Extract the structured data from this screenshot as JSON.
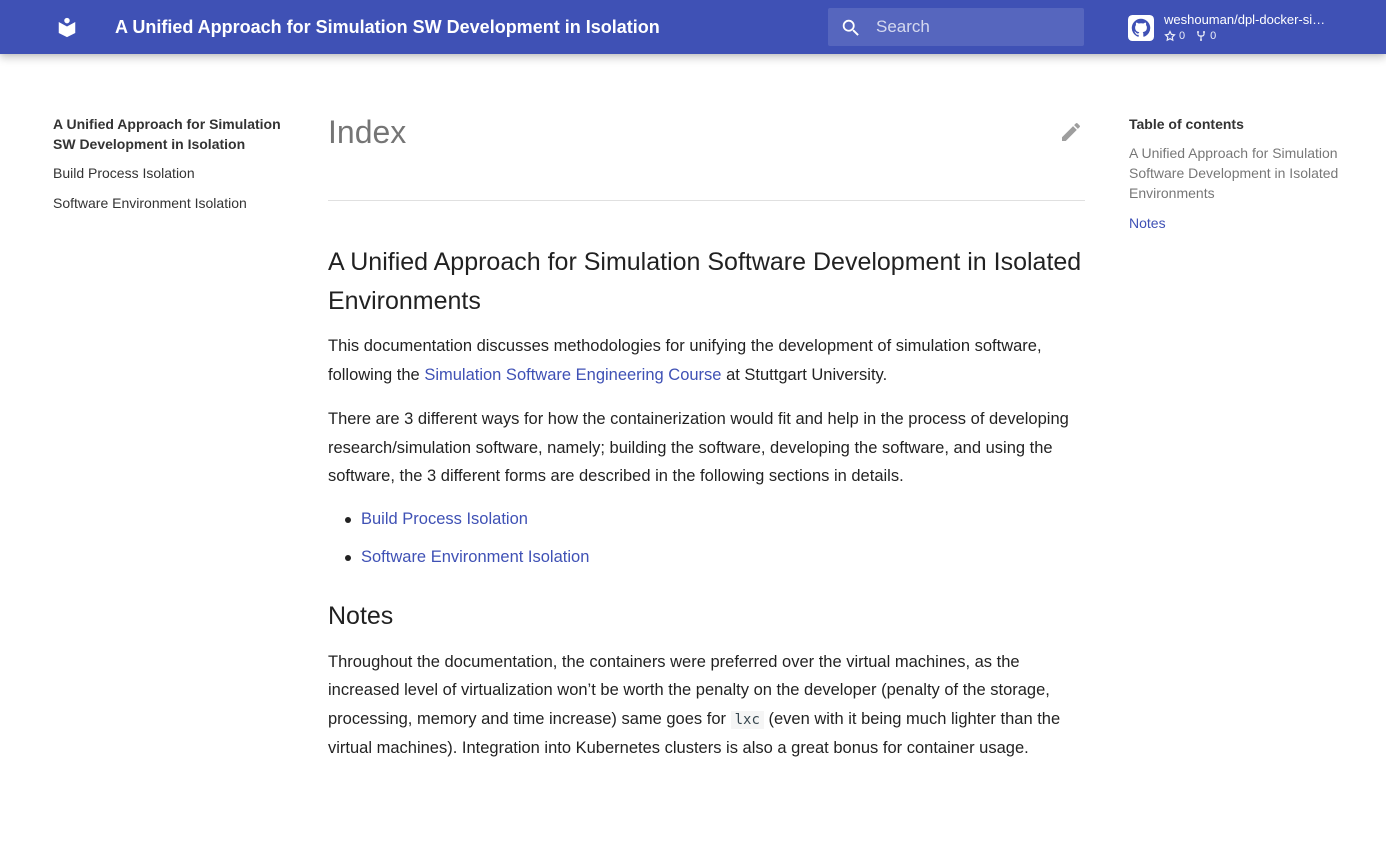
{
  "header": {
    "site_title": "A Unified Approach for Simulation SW Development in Isolation",
    "search_placeholder": "Search",
    "repo_name": "weshouman/dpl-docker-si…",
    "stars": "0",
    "forks": "0"
  },
  "nav": {
    "title": "A Unified Approach for Simulation SW Development in Isolation",
    "items": [
      {
        "label": "Build Process Isolation"
      },
      {
        "label": "Software Environment Isolation"
      }
    ]
  },
  "main": {
    "page_title": "Index",
    "section1_heading": "A Unified Approach for Simulation Software Development in Isolated Environments",
    "p1_before": "This documentation discusses methodologies for unifying the development of simulation software, following the ",
    "p1_link": "Simulation Software Engineering Course",
    "p1_after": " at Stuttgart University.",
    "p2": "There are 3 different ways for how the containerization would fit and help in the process of developing research/simulation software, namely; building the software, developing the software, and using the software, the 3 different forms are described in the following sections in details.",
    "links": [
      {
        "label": "Build Process Isolation"
      },
      {
        "label": "Software Environment Isolation"
      }
    ],
    "notes_heading": "Notes",
    "p3_before": "Throughout the documentation, the containers were preferred over the virtual machines, as the increased level of virtualization won’t be worth the penalty on the developer (penalty of the storage, processing, memory and time increase) same goes for ",
    "p3_code": "lxc",
    "p3_after": " (even with it being much lighter than the virtual machines). Integration into Kubernetes clusters is also a great bonus for container usage."
  },
  "toc": {
    "title": "Table of contents",
    "items": [
      {
        "label": "A Unified Approach for Simulation Software Development in Isolated Environments"
      },
      {
        "label": "Notes"
      }
    ]
  },
  "colors": {
    "primary": "#3f51b5",
    "accent_link": "#3f51b5"
  },
  "icons": [
    "book-logo-icon",
    "search-icon",
    "github-icon",
    "star-icon",
    "fork-icon",
    "edit-pencil-icon"
  ]
}
